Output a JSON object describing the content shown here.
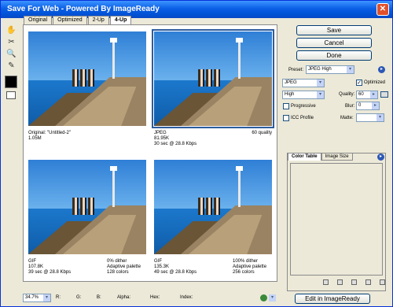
{
  "window": {
    "title": "Save For Web - Powered By ImageReady",
    "close": "✕"
  },
  "tabs": [
    "Original",
    "Optimized",
    "2-Up",
    "4-Up"
  ],
  "tools": {
    "hand": "✋",
    "slice": "✂",
    "zoom": "🔍",
    "eyedropper": "✎"
  },
  "panes": [
    {
      "left1": "Original: \"Untitled-2\"",
      "left2": "1.05M",
      "left3": "",
      "mid1": "",
      "mid2": "",
      "mid3": "",
      "right1": ""
    },
    {
      "left1": "JPEG",
      "left2": "81.95K",
      "left3": "30 sec @ 28.8 Kbps",
      "mid1": "",
      "mid2": "",
      "mid3": "",
      "right1": "60 quality"
    },
    {
      "left1": "GIF",
      "left2": "107.8K",
      "left3": "39 sec @ 28.8 Kbps",
      "mid1": "0% dither",
      "mid2": "Adaptive palette",
      "mid3": "128 colors",
      "right1": ""
    },
    {
      "left1": "GIF",
      "left2": "135.3K",
      "left3": "49 sec @ 28.8 Kbps",
      "mid1": "100% dither",
      "mid2": "Adaptive palette",
      "mid3": "256 colors",
      "right1": ""
    }
  ],
  "buttons": {
    "save": "Save",
    "cancel": "Cancel",
    "done": "Done",
    "edit": "Edit in ImageReady"
  },
  "settings": {
    "preset_label": "Preset:",
    "preset_value": "JPEG High",
    "format": "JPEG",
    "quality_level": "High",
    "optimized_label": "Optimized",
    "quality_label": "Quality:",
    "quality_value": "60",
    "progressive_label": "Progressive",
    "blur_label": "Blur:",
    "blur_value": "0",
    "icc_label": "ICC Profile",
    "matte_label": "Matte:",
    "dropdown_arrow": "▾",
    "checkmark": "✓",
    "arrow": "▸"
  },
  "color_table": {
    "tab1": "Color Table",
    "tab2": "Image Size"
  },
  "status": {
    "zoom": "34.7%",
    "r": "R:",
    "g": "G:",
    "b": "B:",
    "alpha": "Alpha:",
    "hex": "Hex:",
    "index": "Index:"
  }
}
